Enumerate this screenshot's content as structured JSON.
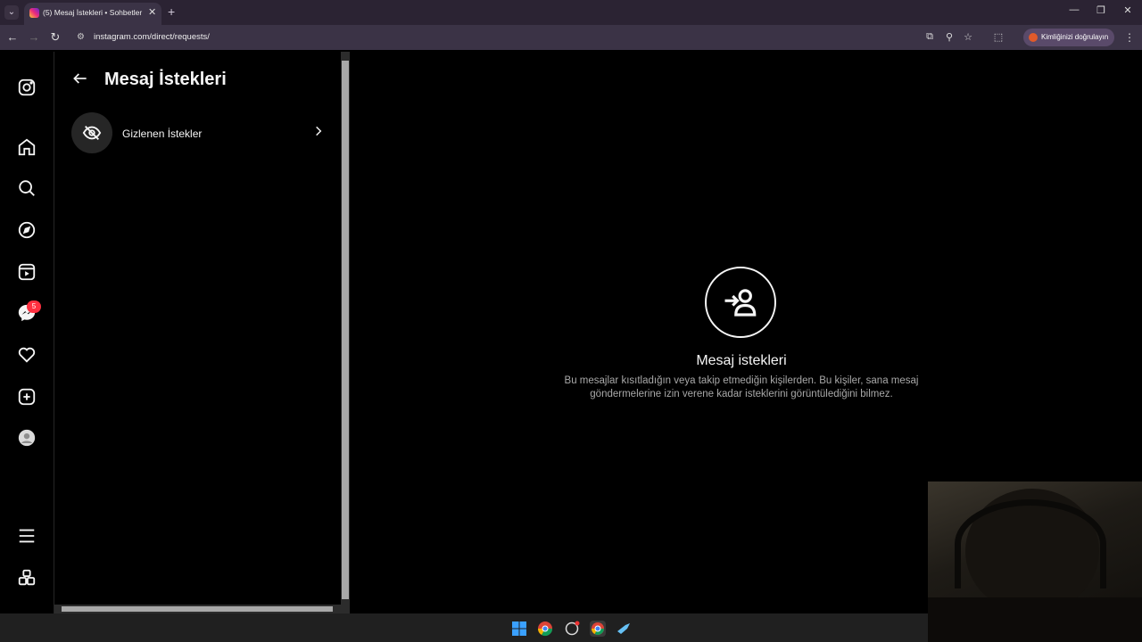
{
  "browser": {
    "tab_title": "(5) Mesaj İstekleri • Sohbetler",
    "url": "instagram.com/direct/requests/",
    "verify_label": "Kimliğinizi doğrulayın"
  },
  "nav": {
    "messages_badge": "5"
  },
  "requests_panel": {
    "title": "Mesaj İstekleri",
    "hidden_requests_label": "Gizlenen İstekler"
  },
  "empty_state": {
    "title": "Mesaj istekleri",
    "description": "Bu mesajlar kısıtladığın veya takip etmediğin kişilerden. Bu kişiler, sana mesaj göndermelerine izin verene kadar isteklerini görüntülediğini bilmez."
  },
  "colors": {
    "background": "#000000",
    "badge": "#ff3040",
    "secondary_text": "#a8a8a8",
    "chrome": "#3b3346"
  }
}
